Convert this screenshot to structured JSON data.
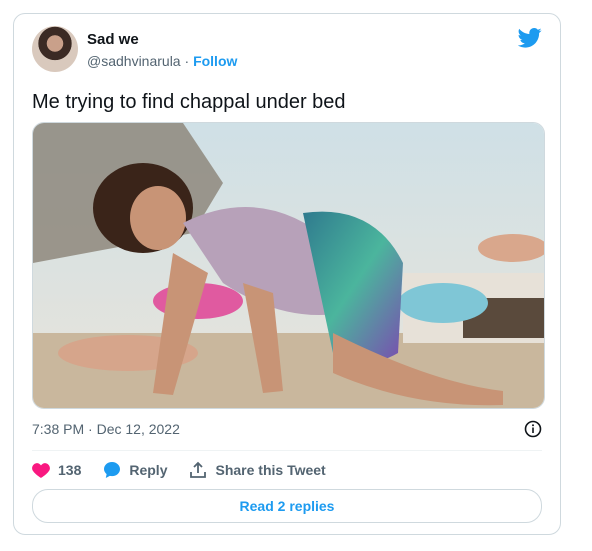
{
  "tweet": {
    "name": "Sad we",
    "handle": "@sadhvinarula",
    "separator": "·",
    "follow_label": "Follow",
    "text": "Me trying to find chappal under bed",
    "timestamp": "7:38 PM · Dec 12, 2022",
    "likes": "138",
    "reply_label": "Reply",
    "share_label": "Share this Tweet",
    "read_replies_label": "Read 2 replies"
  },
  "icons": {
    "brand": "twitter-bird-icon",
    "info": "info-icon",
    "like": "heart-icon",
    "reply": "reply-bubble-icon",
    "share": "share-icon"
  },
  "colors": {
    "accent": "#1d9bf0",
    "like": "#f91880",
    "text_secondary": "#536471",
    "border": "#cfd9de"
  }
}
